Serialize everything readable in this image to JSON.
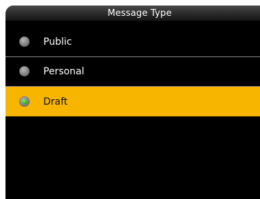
{
  "title": "Message Type",
  "options": [
    {
      "label": "Public",
      "selected": false
    },
    {
      "label": "Personal",
      "selected": false
    },
    {
      "label": "Draft",
      "selected": true
    }
  ],
  "colors": {
    "background": "#000000",
    "selected_row": "#f7b500",
    "selected_dot": "#2fbf18"
  }
}
